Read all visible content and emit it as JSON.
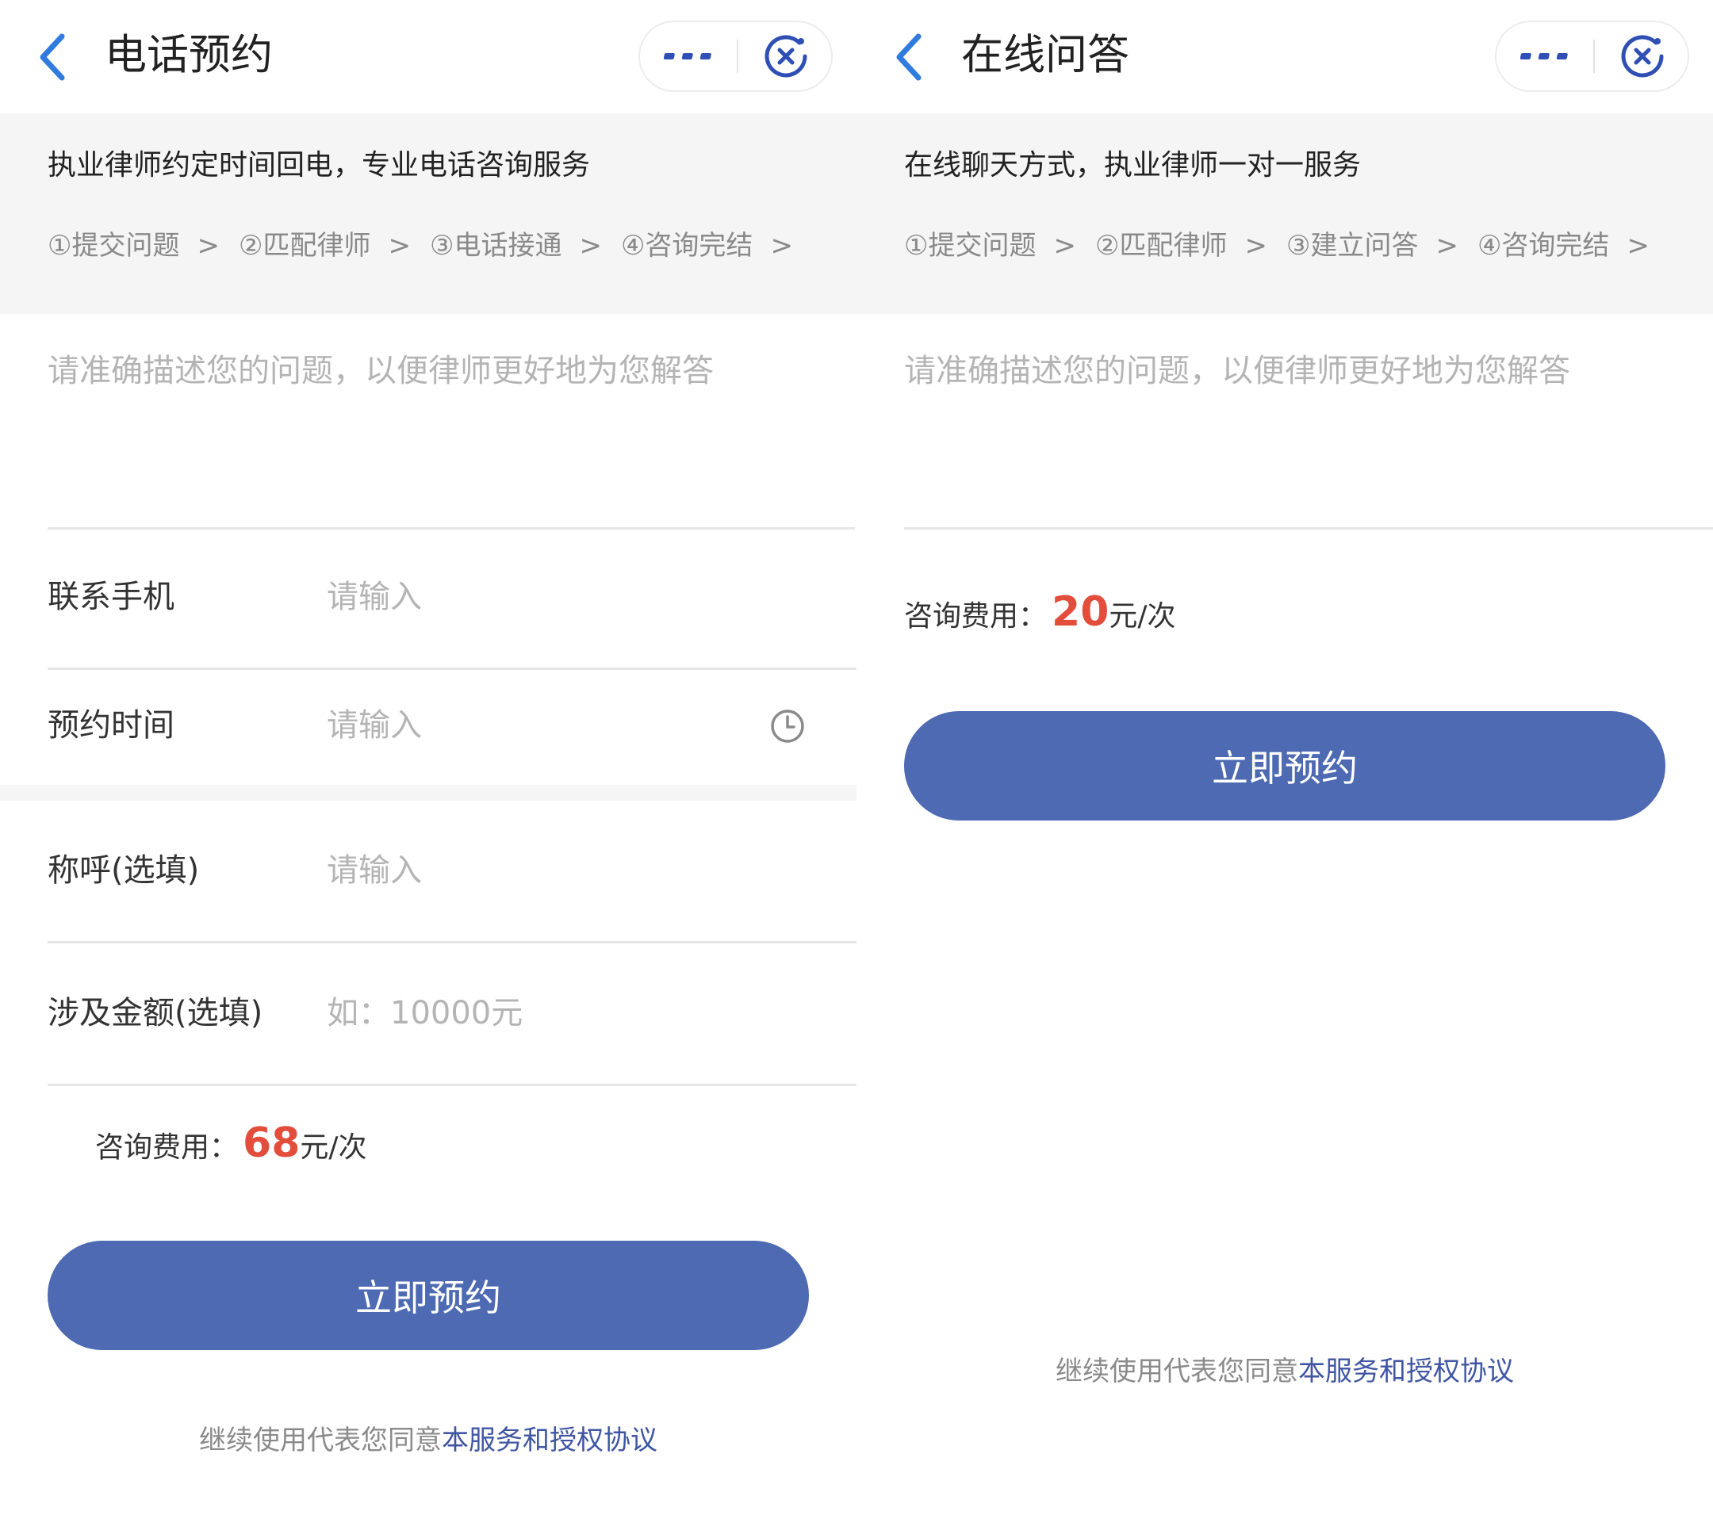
{
  "colors": {
    "accent_blue": "#4d6ab2",
    "fee_red": "#e34d3c",
    "link_blue": "#4056a3",
    "banner_bg": "#f5f5f5",
    "back_icon": "#2f7bde"
  },
  "left": {
    "nav": {
      "title": "电话预约"
    },
    "banner": {
      "desc": "执业律师约定时间回电，专业电话咨询服务",
      "steps": [
        "①提交问题",
        "②匹配律师",
        "③电话接通",
        "④咨询完结"
      ],
      "step_sep": ">"
    },
    "question": {
      "placeholder": "请准确描述您的问题，以便律师更好地为您解答"
    },
    "fields": {
      "phone": {
        "label": "联系手机",
        "placeholder": "请输入"
      },
      "time": {
        "label": "预约时间",
        "placeholder": "请输入"
      },
      "name": {
        "label": "称呼(选填)",
        "placeholder": "请输入"
      },
      "amount": {
        "label": "涉及金额(选填)",
        "placeholder": "如：10000元"
      }
    },
    "fee": {
      "label": "咨询费用：",
      "amount": "68",
      "unit": "元/次"
    },
    "submit_label": "立即预约",
    "agreement": {
      "prefix": "继续使用代表您同意",
      "link": "本服务和授权协议"
    }
  },
  "right": {
    "nav": {
      "title": "在线问答"
    },
    "banner": {
      "desc": "在线聊天方式，执业律师一对一服务",
      "steps": [
        "①提交问题",
        "②匹配律师",
        "③建立问答",
        "④咨询完结"
      ],
      "step_sep": ">"
    },
    "question": {
      "placeholder": "请准确描述您的问题，以便律师更好地为您解答"
    },
    "fee": {
      "label": "咨询费用：",
      "amount": "20",
      "unit": "元/次"
    },
    "submit_label": "立即预约",
    "agreement": {
      "prefix": "继续使用代表您同意",
      "link": "本服务和授权协议"
    }
  }
}
